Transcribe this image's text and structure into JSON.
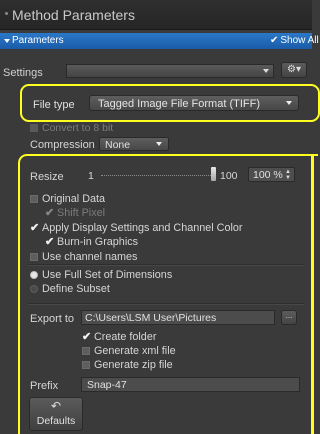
{
  "panel": {
    "title": "Method Parameters"
  },
  "section": {
    "label": "Parameters",
    "show_all_label": "Show All"
  },
  "settings": {
    "label": "Settings",
    "value": "",
    "gear_glyph": "⚙▾"
  },
  "file_type": {
    "label": "File type",
    "value": "Tagged Image File Format (TIFF)"
  },
  "convert_8bit": {
    "label": "Convert to 8 bit",
    "checked": false,
    "enabled": false
  },
  "compression": {
    "label": "Compression",
    "value": "None"
  },
  "resize": {
    "label": "Resize",
    "min": "1",
    "max": "100",
    "value": "100 %",
    "level_percent": 100
  },
  "options": {
    "original_data": "Original Data",
    "shift_pixel": "Shift Pixel",
    "apply_display": "Apply Display Settings and Channel Color",
    "burn_in": "Burn-in Graphics",
    "use_channel_names": "Use channel names"
  },
  "dimensions": {
    "full_set": "Use Full Set of Dimensions",
    "subset": "Define Subset"
  },
  "export": {
    "label": "Export to",
    "path": "C:\\Users\\LSM User\\Pictures",
    "browse": "..."
  },
  "folder_options": {
    "create_folder": "Create folder",
    "xml": "Generate xml file",
    "zip": "Generate zip file"
  },
  "prefix": {
    "label": "Prefix",
    "value": "Snap-47"
  },
  "defaults_button": {
    "label": "Defaults",
    "icon": "↶"
  },
  "colors": {
    "accent": "#1f66b8",
    "highlight": "#ffff22",
    "background": "#3a3a3a"
  }
}
